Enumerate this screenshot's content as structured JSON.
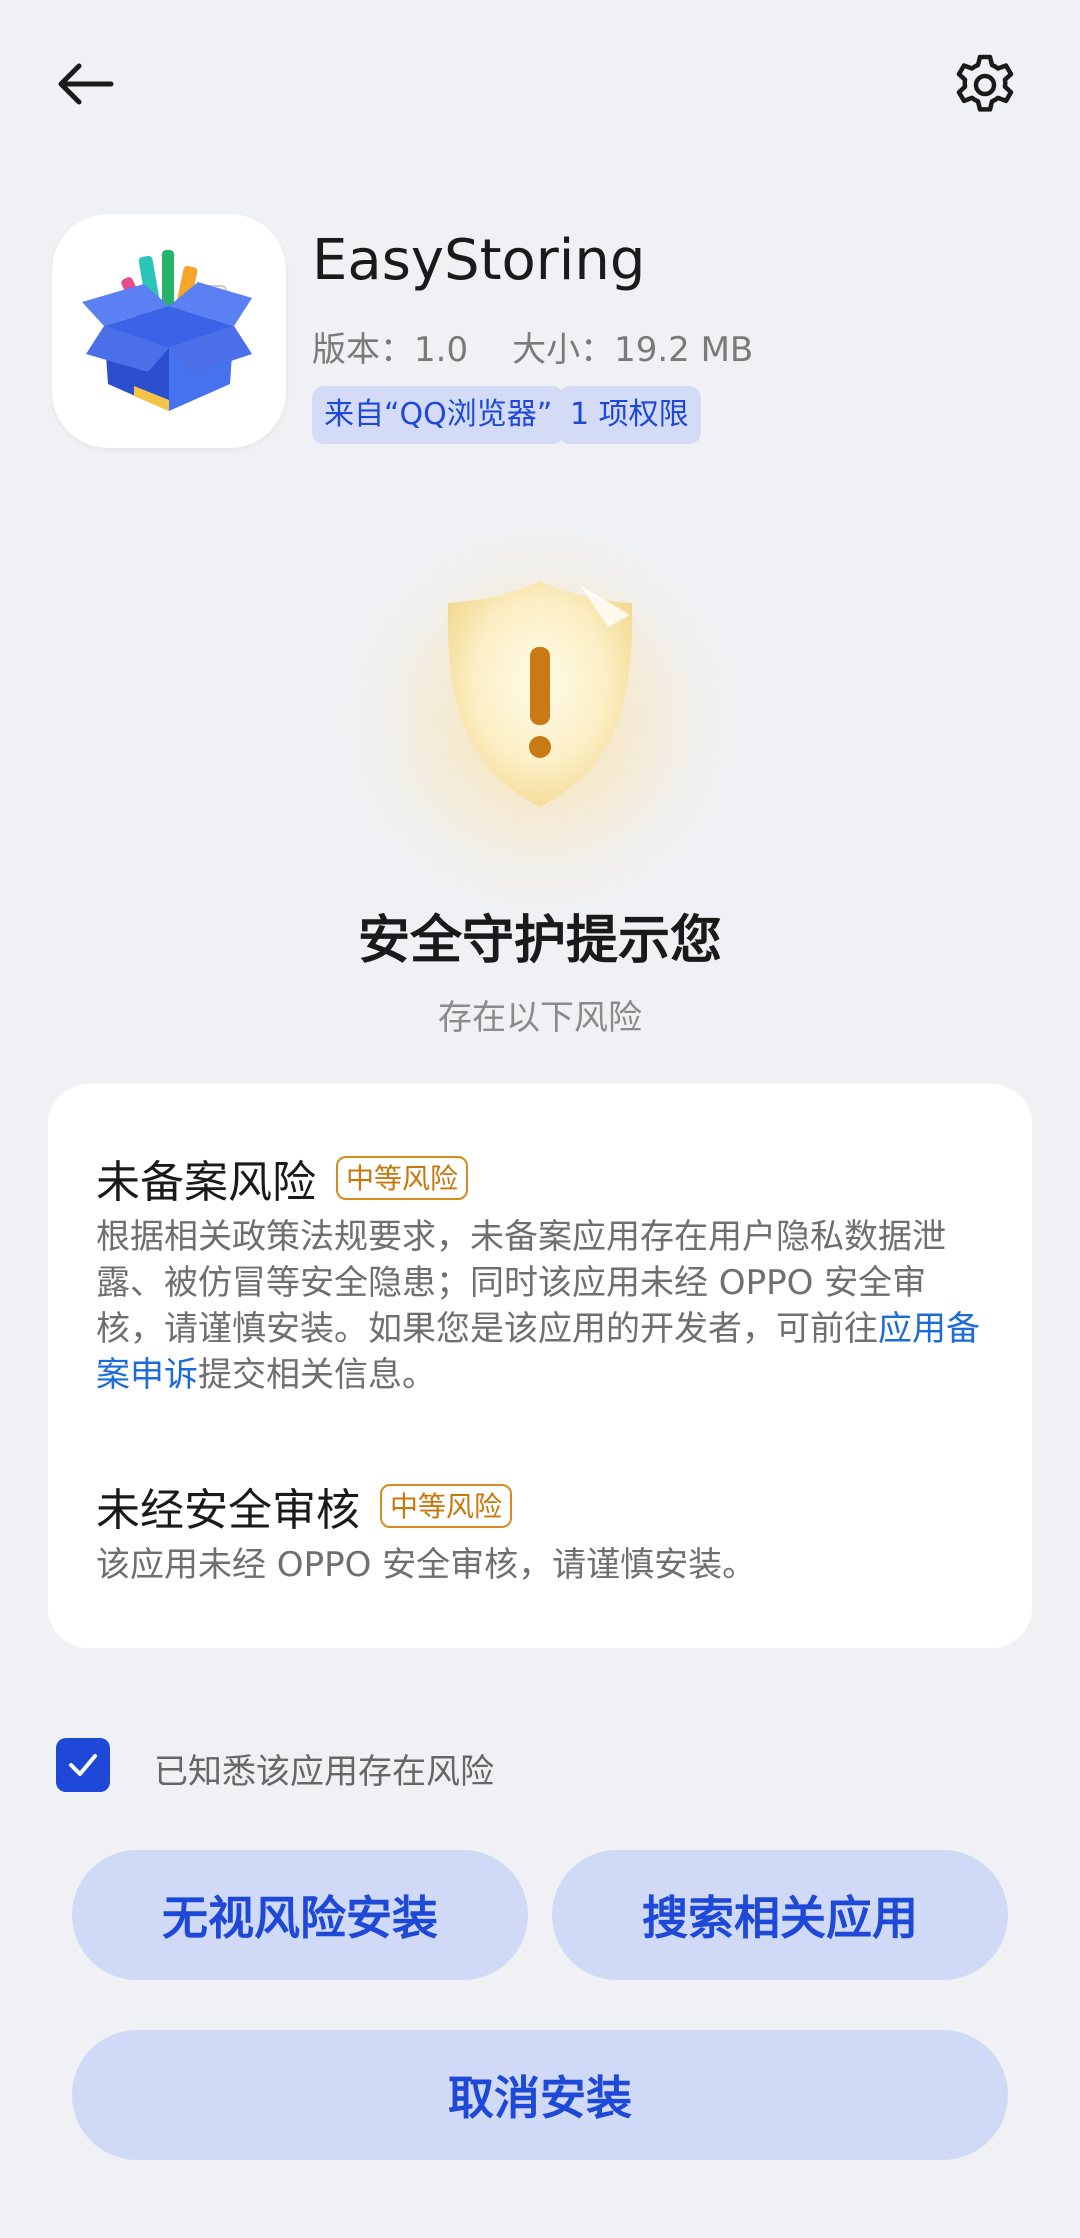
{
  "app": {
    "name": "EasyStoring",
    "version_label": "版本：1.0",
    "size_label": "大小：19.2 MB",
    "source_tag": "来自“QQ浏览器”",
    "permissions_tag": "1 项权限"
  },
  "alert": {
    "title": "安全守护提示您",
    "subtitle": "存在以下风险"
  },
  "risks": [
    {
      "title": "未备案风险",
      "level": "中等风险",
      "description": "根据相关政策法规要求，未备案应用存在用户隐私数据泄露、被仿冒等安全隐患；同时该应用未经 OPPO 安全审核，请谨慎安装。如果您是该应用的开发者，可前往",
      "link_text": "应用备案申诉",
      "description_suffix": "提交相关信息。"
    },
    {
      "title": "未经安全审核",
      "level": "中等风险",
      "description": "该应用未经 OPPO 安全审核，请谨慎安装。"
    }
  ],
  "acknowledge": {
    "label": "已知悉该应用存在风险",
    "checked": true
  },
  "buttons": {
    "ignore_install": "无视风险安装",
    "search_related": "搜索相关应用",
    "cancel_install": "取消安装"
  },
  "icons": {
    "back": "arrow-left-icon",
    "settings": "gear-icon",
    "shield": "shield-warning-icon",
    "check": "check-icon"
  },
  "colors": {
    "accent": "#1d48d8",
    "warning": "#c9760b",
    "background": "#f0f1f5",
    "button_bg": "#d0d9f6"
  }
}
